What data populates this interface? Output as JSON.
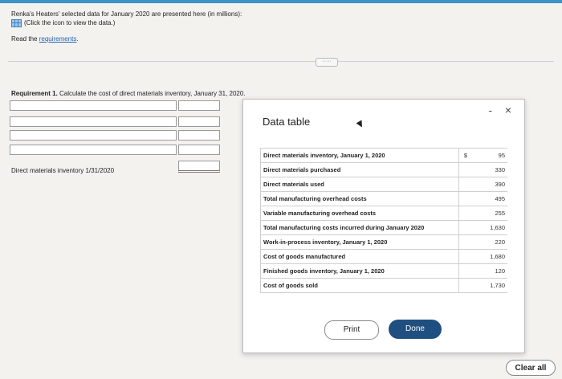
{
  "intro": {
    "text": "Renka's Heaters' selected data for January 2020 are presented here (in millions):",
    "link_hint": "(Click the icon to view the data.)",
    "read_prefix": "Read the ",
    "requirements_link": "requirements",
    "requirements_suffix": "."
  },
  "toggle": {
    "label": "·····"
  },
  "requirement": {
    "label": "Requirement 1.",
    "text": " Calculate the cost of direct materials inventory, January 31, 2020."
  },
  "row_label": "Direct materials inventory 1/31/2020",
  "modal": {
    "title": "Data table",
    "minimize": "-",
    "close": "×",
    "rows": [
      {
        "label": "Direct materials inventory, January 1, 2020",
        "currency": "$",
        "value": "95"
      },
      {
        "label": "Direct materials purchased",
        "currency": "",
        "value": "330"
      },
      {
        "label": "Direct materials used",
        "currency": "",
        "value": "390"
      },
      {
        "label": "Total manufacturing overhead costs",
        "currency": "",
        "value": "495"
      },
      {
        "label": "Variable manufacturing overhead costs",
        "currency": "",
        "value": "255"
      },
      {
        "label": "Total manufacturing costs incurred during January 2020",
        "currency": "",
        "value": "1,630"
      },
      {
        "label": "Work-in-process inventory, January 1, 2020",
        "currency": "",
        "value": "220"
      },
      {
        "label": "Cost of goods manufactured",
        "currency": "",
        "value": "1,680"
      },
      {
        "label": "Finished goods inventory, January 1, 2020",
        "currency": "",
        "value": "120"
      },
      {
        "label": "Cost of goods sold",
        "currency": "",
        "value": "1,730"
      }
    ],
    "print_label": "Print",
    "done_label": "Done"
  },
  "clear_all_label": "Clear all",
  "colors": {
    "accent": "#3f93c9",
    "done_button": "#1f4f80",
    "link": "#2463b6"
  }
}
